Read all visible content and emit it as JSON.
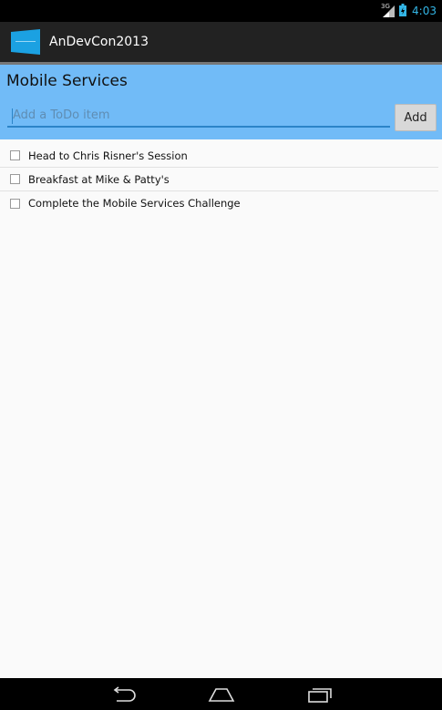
{
  "status_bar": {
    "network": "3G",
    "time": "4:03",
    "icons": [
      "signal-icon",
      "battery-icon"
    ]
  },
  "action_bar": {
    "app_icon": "app-logo-icon",
    "title": "AnDevCon2013"
  },
  "panel": {
    "title": "Mobile Services",
    "input": {
      "value": "",
      "placeholder": "Add a ToDo item"
    },
    "add_label": "Add"
  },
  "todos": [
    {
      "text": "Head to Chris Risner's Session",
      "checked": false
    },
    {
      "text": "Breakfast at Mike & Patty's",
      "checked": false
    },
    {
      "text": "Complete the Mobile Services Challenge",
      "checked": false
    }
  ],
  "nav_bar": {
    "icons": [
      "back-icon",
      "home-icon",
      "recent-apps-icon"
    ]
  },
  "colors": {
    "accent": "#33b5e5",
    "panel": "#71bbf7",
    "action_bar": "#222222"
  }
}
